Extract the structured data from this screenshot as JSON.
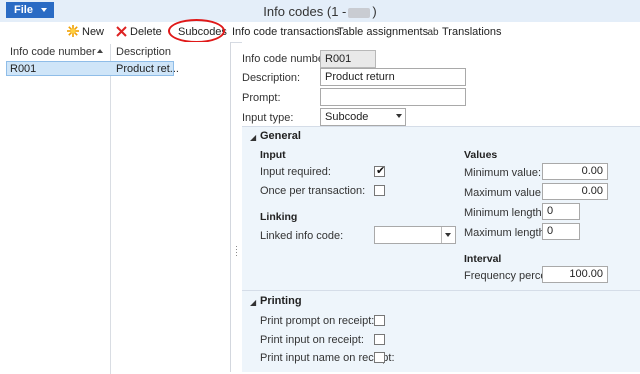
{
  "window": {
    "title": "Info codes (1 -",
    "title_close": ")"
  },
  "ribbon": {
    "file_label": "File",
    "new_label": "New",
    "delete_label": "Delete",
    "subcodes_label": "Subcodes",
    "info_code_transactions_label": "Info code transactions",
    "table_assignments_label": "Table assignments",
    "translations_label": "Translations"
  },
  "list": {
    "columns": [
      "Info code number",
      "Description"
    ],
    "rows": [
      {
        "number": "R001",
        "description": "Product ret..."
      }
    ]
  },
  "header": {
    "info_code_number_label": "Info code number:",
    "info_code_number_value": "R001",
    "description_label": "Description:",
    "description_value": "Product return",
    "prompt_label": "Prompt:",
    "prompt_value": "",
    "input_type_label": "Input type:",
    "input_type_value": "Subcode buttons"
  },
  "general": {
    "title": "General",
    "input_group": "Input",
    "input_required_label": "Input required:",
    "input_required_checked": true,
    "once_per_transaction_label": "Once per transaction:",
    "once_per_transaction_checked": false,
    "linking_group": "Linking",
    "linked_info_code_label": "Linked info code:",
    "linked_info_code_value": "",
    "values_group": "Values",
    "minimum_value_label": "Minimum value:",
    "minimum_value": "0.00",
    "maximum_value_label": "Maximum value:",
    "maximum_value": "0.00",
    "minimum_length_label": "Minimum length:",
    "minimum_length": "0",
    "maximum_length_label": "Maximum length:",
    "maximum_length": "0",
    "interval_group": "Interval",
    "frequency_percent_label": "Frequency percent:",
    "frequency_percent": "100.00"
  },
  "printing": {
    "title": "Printing",
    "print_prompt_label": "Print prompt on receipt:",
    "print_input_label": "Print input on receipt:",
    "print_input_name_label": "Print input name on receipt:"
  },
  "colors": {
    "accent": "#2a6bc4",
    "highlight_ring": "#e01818",
    "selected_row": "#cfe5f8",
    "group_band": "#eef5fb"
  }
}
